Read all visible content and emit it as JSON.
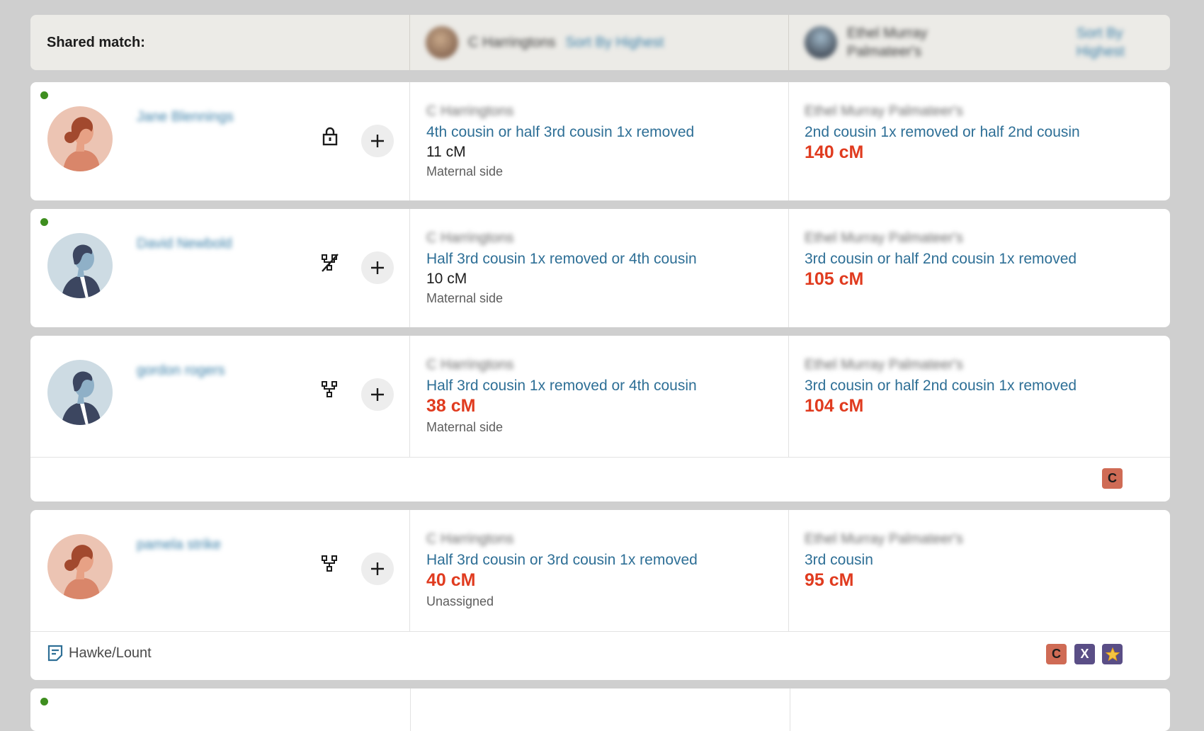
{
  "header": {
    "shared_match_label": "Shared match:",
    "col2_name": "C Harringtons",
    "col2_sort": "Sort By Highest",
    "col3_name_line1": "Ethel Murray",
    "col3_name_line2": "Palmateer's",
    "col3_sort_line1": "Sort By",
    "col3_sort_line2": "Highest"
  },
  "rows": [
    {
      "name": "Jane Blennings",
      "icon": "lock-icon",
      "c2_label": "C Harringtons",
      "c2_rel": "4th cousin or half 3rd cousin 1x removed",
      "c2_cm": "11 cM",
      "c2_side": "Maternal side",
      "c3_label": "Ethel Murray Palmateer's",
      "c3_rel": "2nd cousin 1x removed or half 2nd cousin",
      "c3_cm": "140 cM"
    },
    {
      "name": "David Newbold",
      "icon": "no-tree-icon",
      "c2_label": "C Harringtons",
      "c2_rel": "Half 3rd cousin 1x removed or 4th cousin",
      "c2_cm": "10 cM",
      "c2_side": "Maternal side",
      "c3_label": "Ethel Murray Palmateer's",
      "c3_rel": "3rd cousin or half 2nd cousin 1x removed",
      "c3_cm": "105 cM"
    },
    {
      "name": "gordon rogers",
      "icon": "tree-icon",
      "c2_label": "C Harringtons",
      "c2_rel": "Half 3rd cousin 1x removed or 4th cousin",
      "c2_cm": "38 cM",
      "c2_side": "Maternal side",
      "c3_label": "Ethel Murray Palmateer's",
      "c3_rel": "3rd cousin or half 2nd cousin 1x removed",
      "c3_cm": "104 cM",
      "tags": [
        "C"
      ]
    },
    {
      "name": "pamela strike",
      "icon": "tree-icon",
      "c2_label": "C Harringtons",
      "c2_rel": "Half 3rd cousin or 3rd cousin 1x removed",
      "c2_cm": "40 cM",
      "c2_side": "Unassigned",
      "c3_label": "Ethel Murray Palmateer's",
      "c3_rel": "3rd cousin",
      "c3_cm": "95 cM",
      "note": "Hawke/Lount",
      "tags": [
        "C",
        "X",
        "★"
      ]
    }
  ],
  "colors": {
    "link": "#2e6f96",
    "highlight_cm": "#e03b1f",
    "online_dot": "#3e8e1f",
    "tag_c": "#cf6b55",
    "tag_purple": "#5a4e86"
  }
}
